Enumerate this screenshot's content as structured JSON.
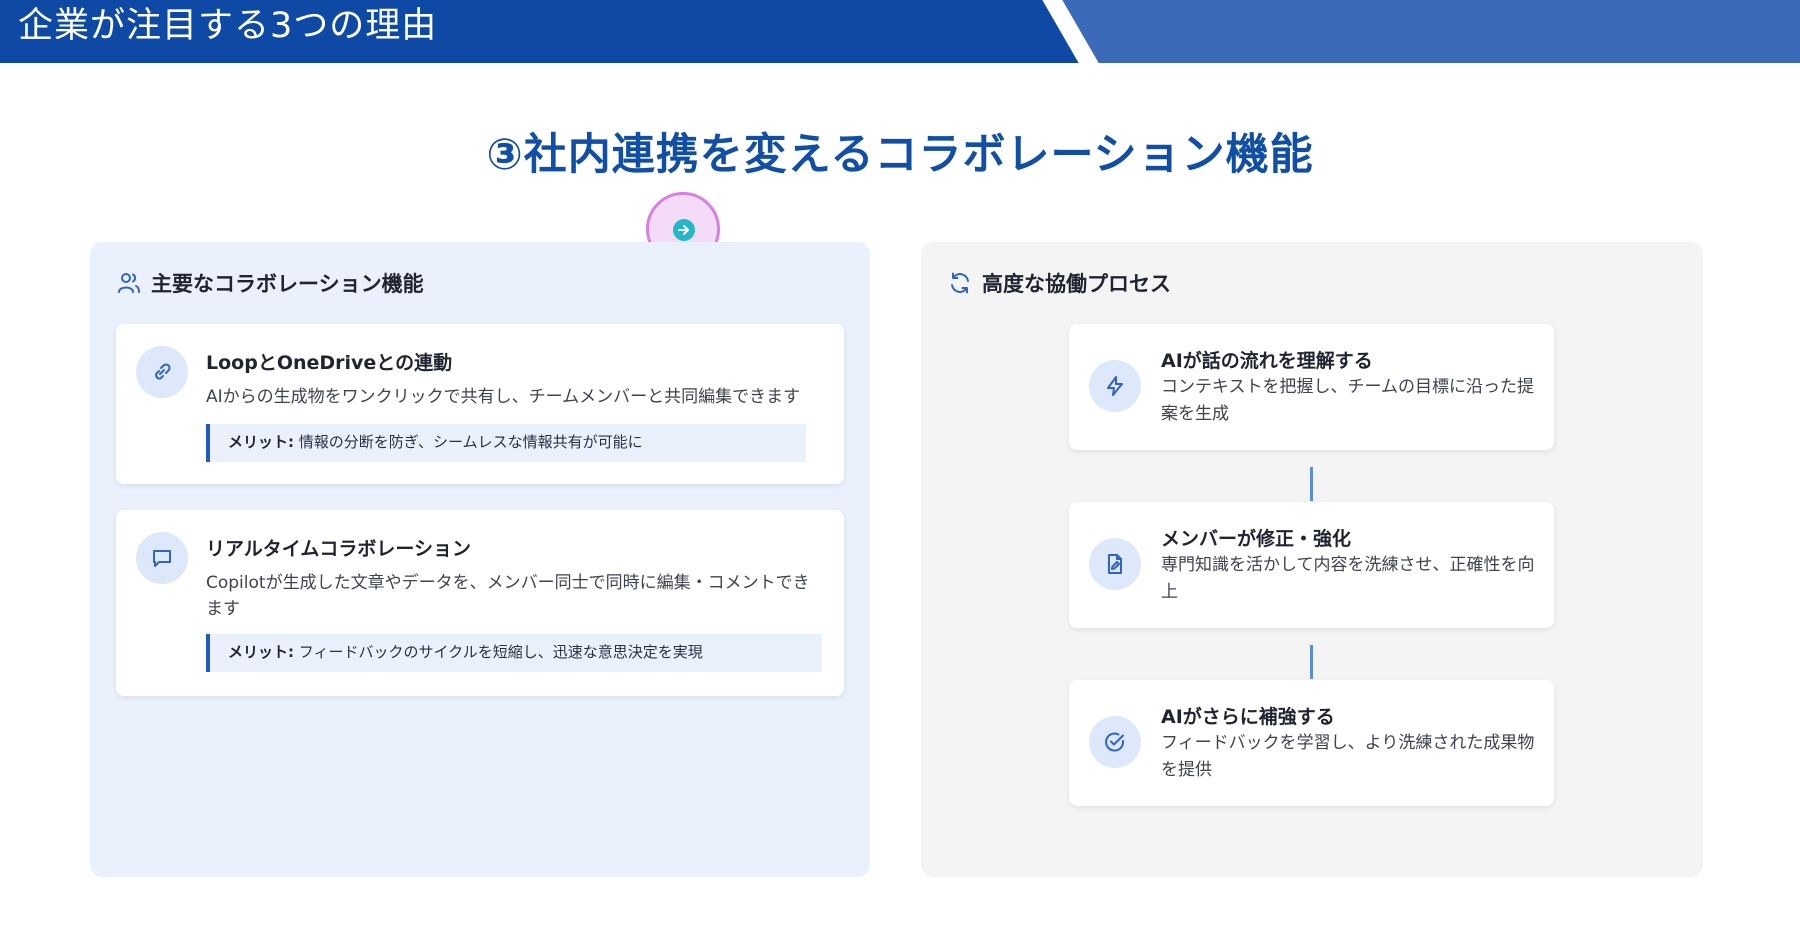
{
  "banner": {
    "title": "企業が注目する3つの理由"
  },
  "main_title": "③社内連携を変えるコラボレーション機能",
  "left_panel": {
    "heading": "主要なコラボレーション機能",
    "icon": "users-icon",
    "cards": [
      {
        "icon": "link-icon",
        "title": "LoopとOneDriveとの連動",
        "description": "AIからの生成物をワンクリックで共有し、チームメンバーと共同編集できます",
        "merit_label": "メリット:",
        "merit_text": " 情報の分断を防ぎ、シームレスな情報共有が可能に"
      },
      {
        "icon": "chat-icon",
        "title": "リアルタイムコラボレーション",
        "description": "Copilotが生成した文章やデータを、メンバー同士で同時に編集・コメントできます",
        "merit_label": "メリット:",
        "merit_text": " フィードバックのサイクルを短縮し、迅速な意思決定を実現"
      }
    ]
  },
  "right_panel": {
    "heading": "高度な協働プロセス",
    "icon": "refresh-icon",
    "steps": [
      {
        "icon": "bolt-icon",
        "title": "AIが話の流れを理解する",
        "description": "コンテキストを把握し、チームの目標に沿った提案を生成"
      },
      {
        "icon": "file-edit-icon",
        "title": "メンバーが修正・強化",
        "description": "専門知識を活かして内容を洗練させ、正確性を向上"
      },
      {
        "icon": "check-circle-icon",
        "title": "AIがさらに補強する",
        "description": "フィードバックを学習し、より洗練された成果物を提供"
      }
    ]
  },
  "colors": {
    "banner": "#0e49a5",
    "accent": "#114ea6",
    "left_panel_bg": "#ebf1fc",
    "right_panel_bg": "#f4f4f5"
  }
}
